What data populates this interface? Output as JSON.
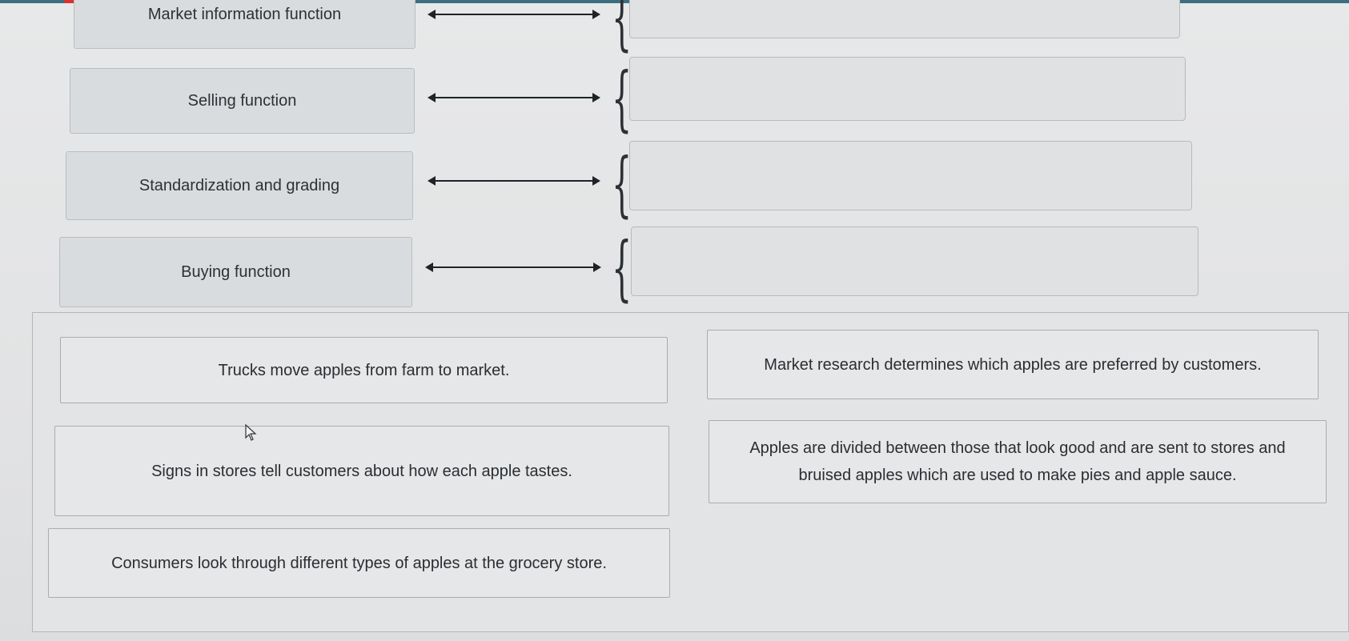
{
  "matching": {
    "rows": [
      {
        "label": "Market information function"
      },
      {
        "label": "Selling function"
      },
      {
        "label": "Standardization and grading"
      },
      {
        "label": "Buying function"
      }
    ]
  },
  "answers": {
    "cards": [
      {
        "text": "Trucks move apples from farm to market."
      },
      {
        "text": "Market research determines which apples are preferred by customers."
      },
      {
        "text": "Signs in stores tell customers about how each apple tastes."
      },
      {
        "text": "Apples are divided between those that look good and are sent to stores and bruised apples which are used to make pies and apple sauce."
      },
      {
        "text": "Consumers look through different types of apples at the grocery store."
      }
    ]
  },
  "colors": {
    "top_bar": "#3b6f80",
    "top_bar_accent": "#d7322f"
  },
  "icons": {
    "arrow": "double-arrow-icon",
    "brace": "left-brace-icon",
    "cursor": "mouse-pointer-icon"
  }
}
